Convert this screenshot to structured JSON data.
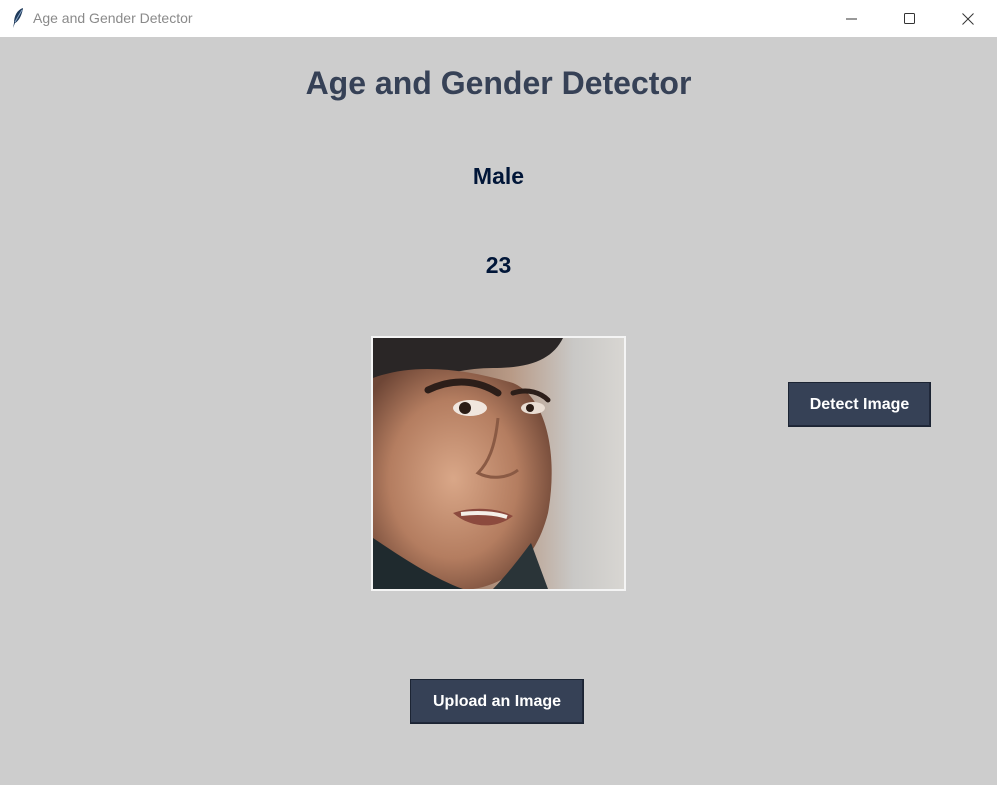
{
  "window": {
    "title": "Age and Gender Detector",
    "icon": "feather-icon",
    "controls": [
      "minimize-icon",
      "maximize-icon",
      "close-icon"
    ]
  },
  "app": {
    "heading": "Age and Gender Detector",
    "gender_result": "Male",
    "age_result": "23",
    "image_description_icon": "portrait-photo",
    "detect_button_label": "Detect Image",
    "upload_button_label": "Upload an Image"
  },
  "colors": {
    "background": "#cdcdcd",
    "heading": "#364156",
    "result_text": "#011638",
    "button_bg": "#364156",
    "button_text": "#ffffff"
  }
}
